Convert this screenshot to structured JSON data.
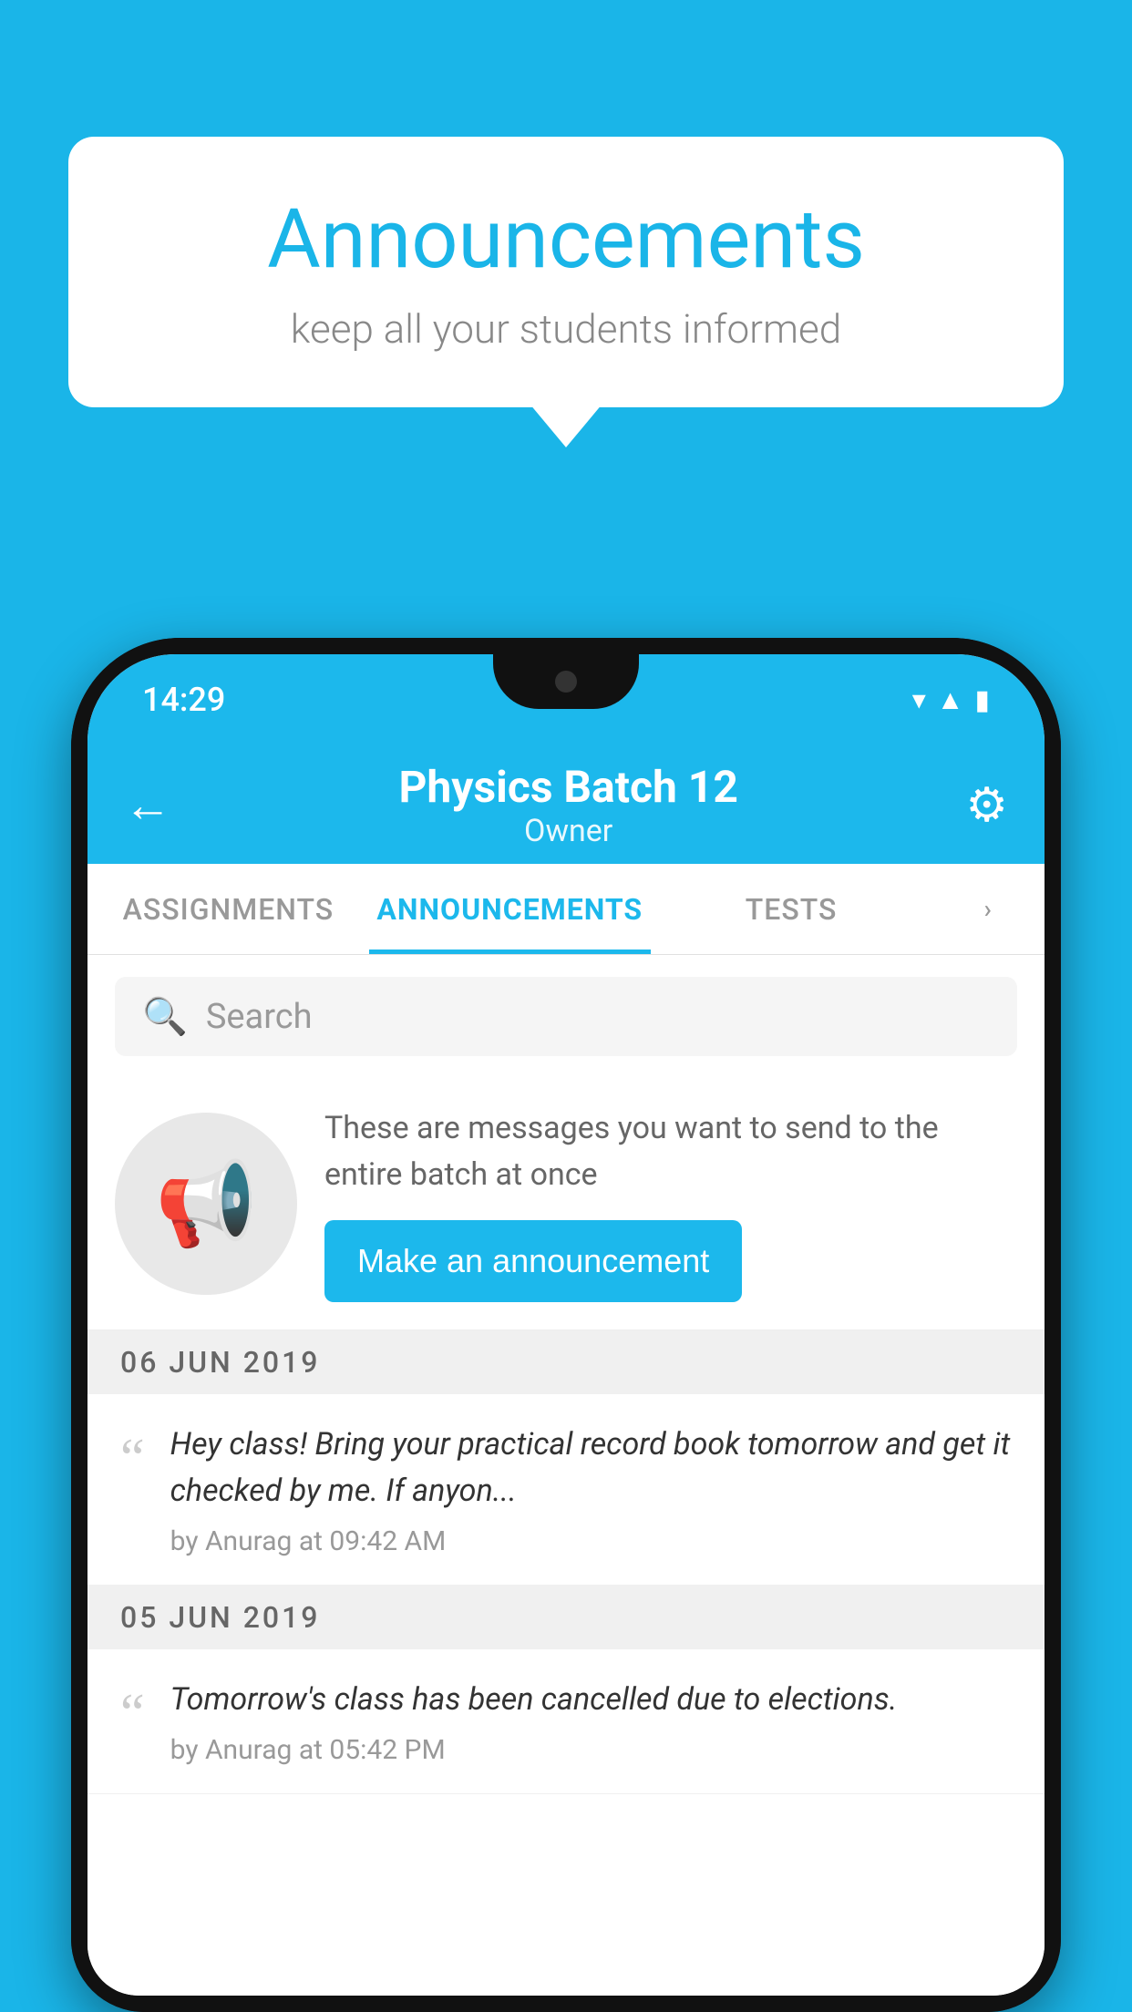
{
  "background_color": "#1ab5e8",
  "speech_bubble": {
    "title": "Announcements",
    "subtitle": "keep all your students informed"
  },
  "phone": {
    "status_bar": {
      "time": "14:29"
    },
    "app_bar": {
      "title": "Physics Batch 12",
      "subtitle": "Owner",
      "back_label": "←",
      "settings_label": "⚙"
    },
    "tabs": [
      {
        "label": "ASSIGNMENTS",
        "active": false
      },
      {
        "label": "ANNOUNCEMENTS",
        "active": true
      },
      {
        "label": "TESTS",
        "active": false
      },
      {
        "label": "···",
        "active": false
      }
    ],
    "search": {
      "placeholder": "Search"
    },
    "promo": {
      "text": "These are messages you want to send to the entire batch at once",
      "button_label": "Make an announcement"
    },
    "announcements": [
      {
        "date": "06  JUN  2019",
        "text": "Hey class! Bring your practical record book tomorrow and get it checked by me. If anyon...",
        "meta": "by Anurag at 09:42 AM"
      },
      {
        "date": "05  JUN  2019",
        "text": "Tomorrow's class has been cancelled due to elections.",
        "meta": "by Anurag at 05:42 PM"
      }
    ]
  }
}
